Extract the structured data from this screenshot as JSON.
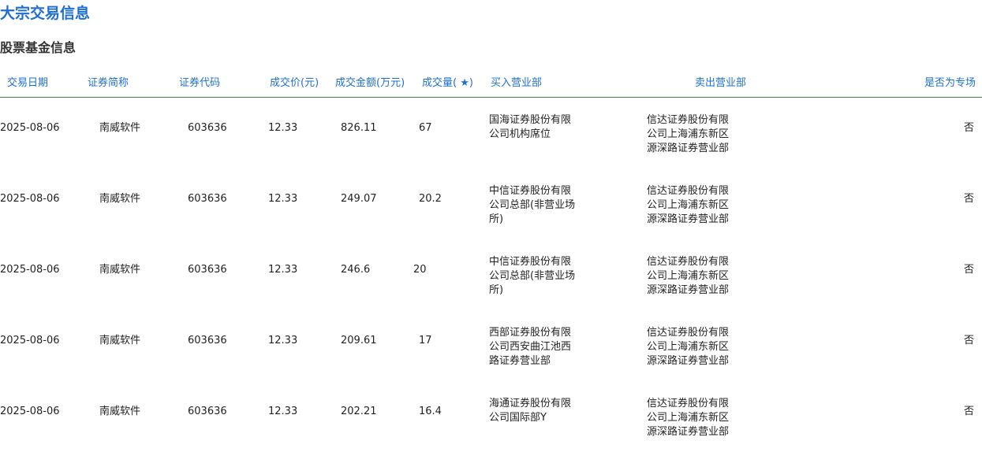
{
  "header": {
    "title": "大宗交易信息",
    "section_title": "股票基金信息"
  },
  "table": {
    "columns": {
      "date": "交易日期",
      "name": "证券简称",
      "code": "证券代码",
      "price": "成交价(元)",
      "amount": "成交金额(万元)",
      "volume": "成交量( ★)",
      "buyer": "买入营业部",
      "seller": "卖出营业部",
      "special": "是否为专场"
    },
    "rows": [
      {
        "date": "2025-08-06",
        "name": "南威软件",
        "code": "603636",
        "price": "12.33",
        "amount": "826.11",
        "volume": "67",
        "buyer": "国海证券股份有限公司机构席位",
        "seller": "信达证券股份有限公司上海浦东新区源深路证券营业部",
        "special": "否"
      },
      {
        "date": "2025-08-06",
        "name": "南威软件",
        "code": "603636",
        "price": "12.33",
        "amount": "249.07",
        "volume": "20.2",
        "buyer": "中信证券股份有限公司总部(非营业场所)",
        "seller": "信达证券股份有限公司上海浦东新区源深路证券营业部",
        "special": "否"
      },
      {
        "date": "2025-08-06",
        "name": "南威软件",
        "code": "603636",
        "price": "12.33",
        "amount": "246.6",
        "volume": "20",
        "buyer": "中信证券股份有限公司总部(非营业场所)",
        "seller": "信达证券股份有限公司上海浦东新区源深路证券营业部",
        "special": "否"
      },
      {
        "date": "2025-08-06",
        "name": "南威软件",
        "code": "603636",
        "price": "12.33",
        "amount": "209.61",
        "volume": "17",
        "buyer": "西部证券股份有限公司西安曲江池西路证券营业部",
        "seller": "信达证券股份有限公司上海浦东新区源深路证券营业部",
        "special": "否"
      },
      {
        "date": "2025-08-06",
        "name": "南威软件",
        "code": "603636",
        "price": "12.33",
        "amount": "202.21",
        "volume": "16.4",
        "buyer": "海通证券股份有限公司国际部Y",
        "seller": "信达证券股份有限公司上海浦东新区源深路证券营业部",
        "special": "否"
      }
    ]
  },
  "colors": {
    "accent_blue": "#1f6fd1",
    "header_rule_green": "#3a7d44"
  }
}
